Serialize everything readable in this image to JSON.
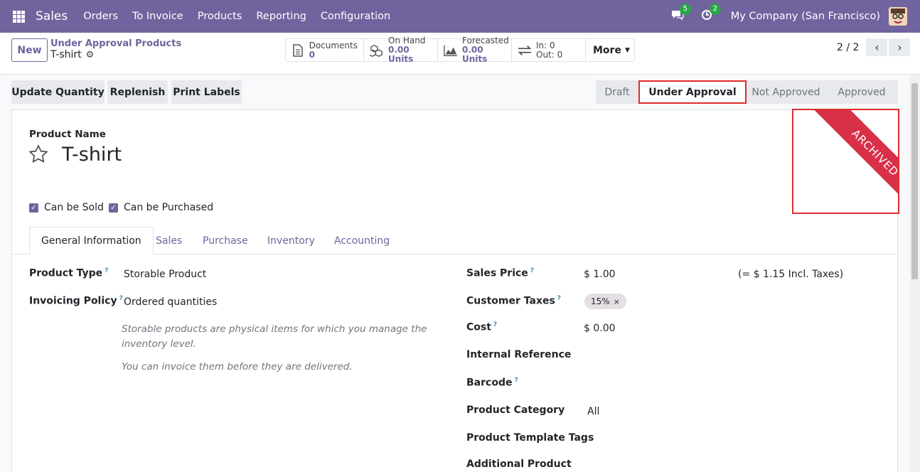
{
  "navbar": {
    "app_name": "Sales",
    "menu": [
      "Orders",
      "To Invoice",
      "Products",
      "Reporting",
      "Configuration"
    ],
    "messages_count": "5",
    "activities_count": "2",
    "company": "My Company (San Francisco)",
    "accent_color": "#71639e",
    "badge_color": "#28a745"
  },
  "control_panel": {
    "new_label": "New",
    "breadcrumb_parent": "Under Approval Products",
    "breadcrumb_current": "T-shirt",
    "smart_buttons": {
      "documents": {
        "label": "Documents",
        "value": "0",
        "icon": "file-icon"
      },
      "on_hand": {
        "label": "On Hand",
        "value": "0.00 Units",
        "icon": "cubes-icon"
      },
      "forecasted": {
        "label": "Forecasted",
        "value": "0.00 Units",
        "icon": "area-chart-icon"
      },
      "moves": {
        "in_label": "In: 0",
        "out_label": "Out: 0",
        "icon": "exchange-icon"
      },
      "more_label": "More"
    },
    "pager": "2 / 2"
  },
  "actions": {
    "update_quantity": "Update Quantity",
    "replenish": "Replenish",
    "print_labels": "Print Labels"
  },
  "statusbar": {
    "stages": [
      "Draft",
      "Under Approval",
      "Not Approved",
      "Approved"
    ],
    "current": "Under Approval"
  },
  "form": {
    "product_name_label": "Product Name",
    "product_name": "T-shirt",
    "ribbon": "ARCHIVED",
    "can_be_sold": "Can be Sold",
    "can_be_purchased": "Can be Purchased",
    "tabs": [
      "General Information",
      "Sales",
      "Purchase",
      "Inventory",
      "Accounting"
    ],
    "left": {
      "product_type_label": "Product Type",
      "product_type": "Storable Product",
      "invoicing_policy_label": "Invoicing Policy",
      "invoicing_policy": "Ordered quantities",
      "help_1": "Storable products are physical items for which you manage the inventory level.",
      "help_2": "You can invoice them before they are delivered."
    },
    "right": {
      "sales_price_label": "Sales Price",
      "sales_price": "$ 1.00",
      "incl_taxes": "(= $ 1.15 Incl. Taxes)",
      "customer_taxes_label": "Customer Taxes",
      "customer_tax_tag": "15%",
      "cost_label": "Cost",
      "cost": "$ 0.00",
      "internal_reference_label": "Internal Reference",
      "barcode_label": "Barcode",
      "product_category_label": "Product Category",
      "product_category": "All",
      "template_tags_label": "Product Template Tags",
      "additional_product_label": "Additional Product"
    },
    "help_marker": "?"
  }
}
